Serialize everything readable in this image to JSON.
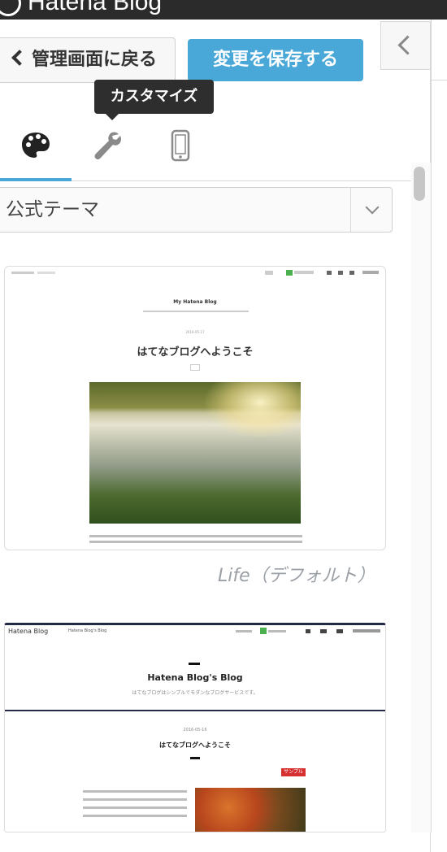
{
  "topbar": {
    "brand": "Hatena Blog"
  },
  "header": {
    "back_label": "管理画面に戻る",
    "save_label": "変更を保存する",
    "tooltip": "カスタマイズ"
  },
  "tabs": [
    {
      "name": "design",
      "icon": "palette-icon",
      "active": true
    },
    {
      "name": "customize",
      "icon": "wrench-icon",
      "active": false
    },
    {
      "name": "smartphone",
      "icon": "smartphone-icon",
      "active": false
    }
  ],
  "theme_select": {
    "value": "公式テーマ"
  },
  "themes": [
    {
      "label": "Life（デフォルト）",
      "preview": {
        "blog_title": "My Hatena Blog",
        "date": "2016-05-17",
        "post_title": "はてなブログへようこそ"
      }
    },
    {
      "preview": {
        "nav_brand": "Hatena Blog",
        "nav_blog": "Hatena Blog's Blog",
        "blog_title": "Hatena Blog's Blog",
        "subtitle": "はてなブログはシンプルでモダンなブログサービスです。",
        "date": "2016-05-16",
        "post_title": "はてなブログへようこそ",
        "tag": "サンプル"
      }
    }
  ],
  "colors": {
    "accent": "#4aa8d8",
    "topbar": "#2b2b2b"
  }
}
